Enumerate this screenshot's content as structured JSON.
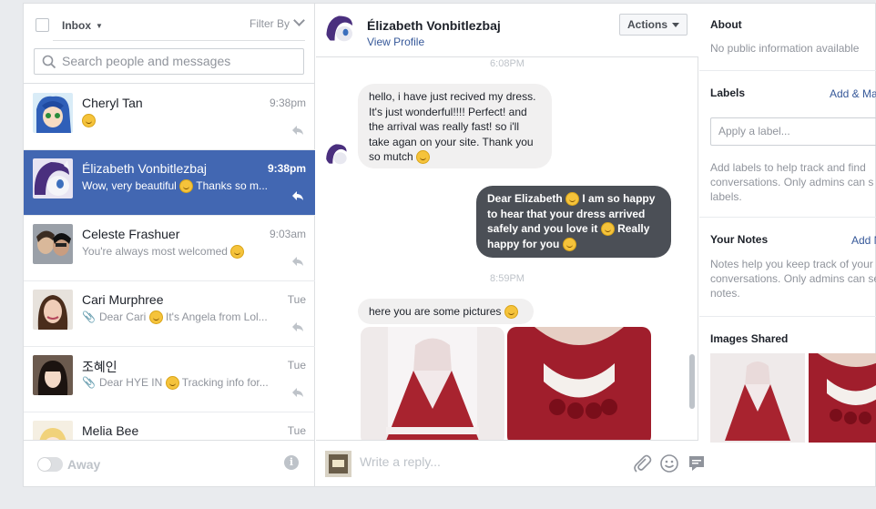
{
  "colors": {
    "brand": "#4267b2",
    "link": "#365899",
    "muted": "#90949c",
    "outgoing_bubble": "#4b4f56",
    "incoming_bubble": "#f1f0f0"
  },
  "left": {
    "inbox_label": "Inbox",
    "filter_label": "Filter By",
    "search_placeholder": "Search people and messages",
    "conversations": [
      {
        "name": "Cheryl Tan",
        "time": "9:38pm",
        "snippet": "",
        "emoji": true,
        "selected": false
      },
      {
        "name": "Élizabeth Vonbitlezbaj",
        "time": "9:38pm",
        "snippet": "Wow, very beautiful",
        "snippet_after": "Thanks so m...",
        "emoji": true,
        "selected": true
      },
      {
        "name": "Celeste Frashuer",
        "time": "9:03am",
        "snippet": "You're always most welcomed",
        "emoji": true,
        "selected": false
      },
      {
        "name": "Cari Murphree",
        "time": "Tue",
        "snippet": "Dear Cari",
        "snippet_after": "It's Angela from Lol...",
        "emoji": true,
        "attachment": true
      },
      {
        "name": "조혜인",
        "time": "Tue",
        "snippet": "Dear HYE IN",
        "snippet_after": "Tracking info for...",
        "emoji": true,
        "attachment": true
      },
      {
        "name": "Melia Bee",
        "time": "Tue",
        "snippet": ""
      }
    ],
    "away_label": "Away",
    "info_glyph": "i"
  },
  "thread": {
    "contact_name": "Élizabeth Vonbitlezbaj",
    "view_profile": "View Profile",
    "actions_label": "Actions",
    "time_1": "6:08PM",
    "msg_1": [
      "hello, i have just recived my dress.",
      "It's just wonderful!!!! Perfect! and",
      "the arrival was really fast! so i'll",
      "take agan on your site. Thank you",
      "so mutch"
    ],
    "msg_2": [
      "Dear Elizabeth",
      "I am so happy",
      "to hear that your dress arrived",
      "safely and you love it",
      "Really",
      "happy for you"
    ],
    "time_2": "8:59PM",
    "msg_3": "here you are some pictures",
    "reply_placeholder": "Write a reply..."
  },
  "right": {
    "about_title": "About",
    "about_text": "No public information available",
    "labels_title": "Labels",
    "labels_add": "Add & Ma",
    "label_placeholder": "Apply a label...",
    "labels_help": [
      "Add labels to help track and find",
      "conversations. Only admins can s",
      "labels."
    ],
    "notes_title": "Your Notes",
    "notes_add": "Add N",
    "notes_help": [
      "Notes help you keep track of your",
      "conversations. Only admins can se",
      "notes."
    ],
    "images_title": "Images Shared"
  },
  "icons": [
    "caret-down-icon",
    "chevron-down-icon",
    "search-icon",
    "reply-icon",
    "paperclip-icon",
    "smile-icon",
    "stickers-icon",
    "info-icon"
  ]
}
